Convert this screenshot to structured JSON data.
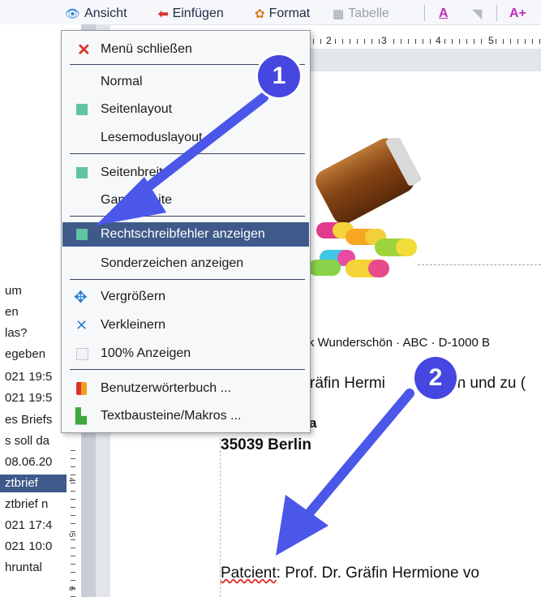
{
  "toolbar": {
    "ansicht": "Ansicht",
    "einfuegen": "Einfügen",
    "format": "Format",
    "tabelle": "Tabelle"
  },
  "left_list": [
    "um",
    "en",
    "las?",
    "egeben",
    "021 19:5",
    "021 19:5",
    "es Briefs",
    "s soll da",
    "08.06.20",
    "ztbrief",
    "ztbrief n",
    "021 17:4",
    "021 10:0",
    "hruntal"
  ],
  "left_selected_index": 9,
  "ruler": {
    "h_numbers": [
      "2",
      "3",
      "4",
      "5"
    ],
    "v_numbers": [
      "4",
      "5",
      "6"
    ]
  },
  "menu": {
    "close": "Menü schließen",
    "normal": "Normal",
    "seitenlayout": "Seitenlayout",
    "lesemodus": "Lesemoduslayout",
    "seitenbreite": "Seitenbreite",
    "ganze_seite": "Ganze Seite",
    "rechtschreib": "Rechtschreibfehler anzeigen",
    "sonderzeichen": "Sonderzeichen anzeigen",
    "vergroessern": "Vergrößern",
    "verkleinern": "Verkleinern",
    "anzeigen100": "100% Anzeigen",
    "benutzerwb": "Benutzerwörterbuch ...",
    "textbausteine": "Textbausteine/Makros ..."
  },
  "document": {
    "sender_line": "k Wunderschön · ABC · D-1000 B",
    "recipient": "räfin Hermi",
    "recipient_rest": "on und zu (",
    "street_fragment": "a",
    "city": "35039 Berlin",
    "patient_word": "Patcient",
    "patient_rest": ": Prof. Dr. Gräfin Hermione vo"
  },
  "annotations": {
    "badge1": "1",
    "badge2": "2"
  },
  "colors": {
    "highlight": "#3f5a8a",
    "badge": "#4646e0",
    "checkmark": "#5fc4a0",
    "close_x": "#d9332b"
  }
}
